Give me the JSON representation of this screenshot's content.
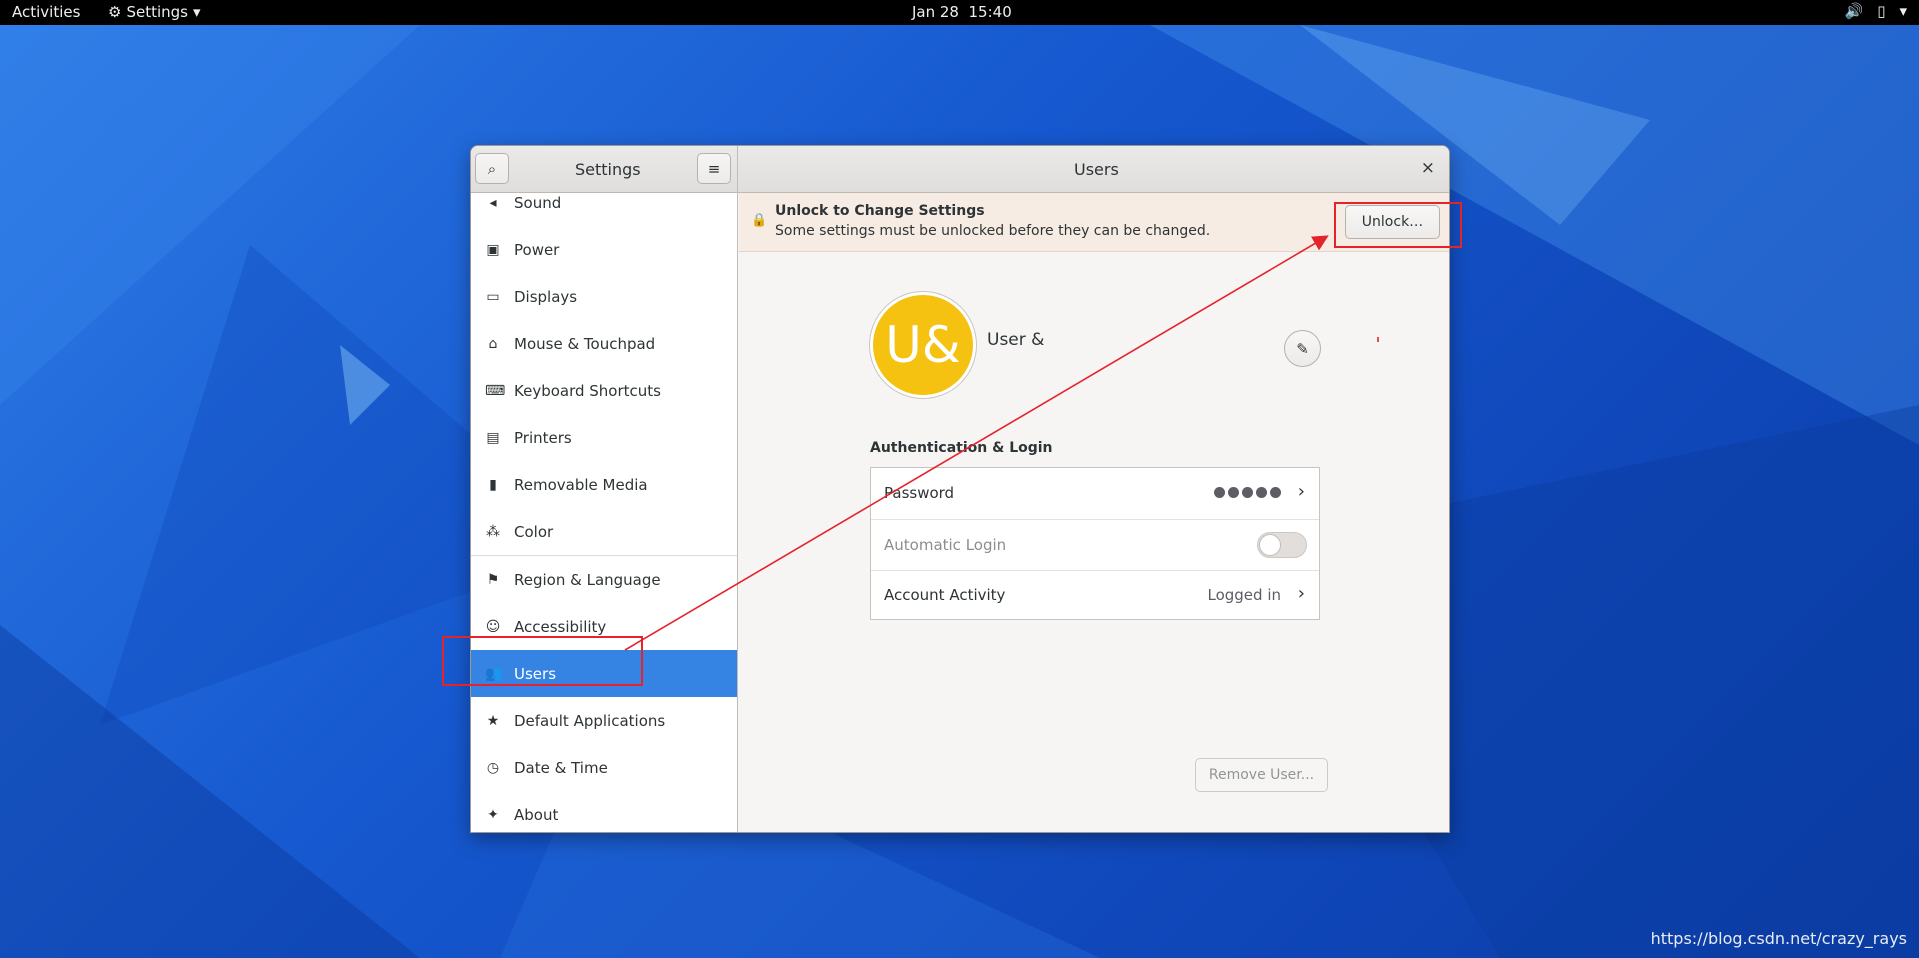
{
  "topbar": {
    "activities": "Activities",
    "app_menu": "Settings",
    "clock": "Jan 28  15:40",
    "icons": [
      "volume-icon",
      "battery-icon",
      "power-menu-icon"
    ]
  },
  "window": {
    "sidebar_title": "Settings",
    "content_title": "Users",
    "close": "×"
  },
  "sidebar": {
    "items": [
      {
        "label": "Sound",
        "icon": "speaker-icon"
      },
      {
        "label": "Power",
        "icon": "power-icon"
      },
      {
        "label": "Displays",
        "icon": "display-icon"
      },
      {
        "label": "Mouse & Touchpad",
        "icon": "mouse-icon"
      },
      {
        "label": "Keyboard Shortcuts",
        "icon": "keyboard-icon"
      },
      {
        "label": "Printers",
        "icon": "printer-icon"
      },
      {
        "label": "Removable Media",
        "icon": "usb-icon"
      },
      {
        "label": "Color",
        "icon": "color-icon"
      },
      {
        "label": "Region & Language",
        "icon": "flag-icon"
      },
      {
        "label": "Accessibility",
        "icon": "accessibility-icon"
      },
      {
        "label": "Users",
        "icon": "users-icon",
        "active": true
      },
      {
        "label": "Default Applications",
        "icon": "star-icon"
      },
      {
        "label": "Date & Time",
        "icon": "clock-icon"
      },
      {
        "label": "About",
        "icon": "sparkle-icon"
      }
    ]
  },
  "infobar": {
    "title": "Unlock to Change Settings",
    "subtitle": "Some settings must be unlocked before they can be changed.",
    "unlock_label": "Unlock…"
  },
  "user": {
    "avatar_initials": "U&",
    "avatar_color": "#f5c211",
    "name": "User &"
  },
  "auth": {
    "section_title": "Authentication & Login",
    "password_label": "Password",
    "password_dots": 5,
    "auto_login_label": "Automatic Login",
    "auto_login_on": false,
    "activity_label": "Account Activity",
    "activity_value": "Logged in"
  },
  "actions": {
    "remove_user": "Remove User..."
  },
  "watermark": "https://blog.csdn.net/crazy_rays",
  "colors": {
    "accent": "#3584e4",
    "annotation": "#e5232b"
  }
}
